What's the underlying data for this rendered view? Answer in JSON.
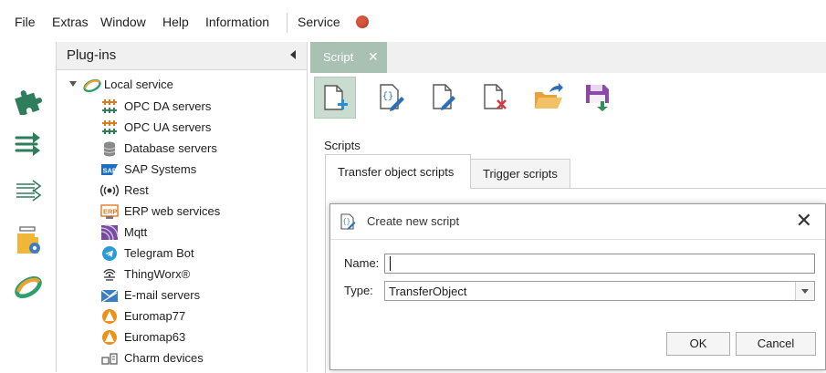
{
  "menu": {
    "items": [
      "File",
      "Extras",
      "Window",
      "Help",
      "Information"
    ],
    "service_label": "Service",
    "service_status_color": "#d9563e"
  },
  "side_strip": {
    "icons": [
      "puzzle-icon",
      "transfer-arrows-icon",
      "transfer-outline-arrows-icon",
      "server-settings-icon",
      "ring-logo-icon"
    ],
    "accent_color": "#2e7d5b"
  },
  "plugins_pane": {
    "title": "Plug-ins",
    "root": {
      "label": "Local service",
      "icon": "local-service-icon",
      "expanded": true
    },
    "items": [
      {
        "label": "OPC DA servers",
        "icon": "opc-da-icon"
      },
      {
        "label": "OPC UA servers",
        "icon": "opc-ua-icon"
      },
      {
        "label": "Database servers",
        "icon": "database-icon"
      },
      {
        "label": "SAP Systems",
        "icon": "sap-icon"
      },
      {
        "label": "Rest",
        "icon": "rest-icon"
      },
      {
        "label": "ERP web services",
        "icon": "erp-icon"
      },
      {
        "label": "Mqtt",
        "icon": "mqtt-icon"
      },
      {
        "label": "Telegram Bot",
        "icon": "telegram-icon"
      },
      {
        "label": "ThingWorx®",
        "icon": "thingworx-icon"
      },
      {
        "label": "E-mail servers",
        "icon": "email-icon"
      },
      {
        "label": "Euromap77",
        "icon": "euromap-icon"
      },
      {
        "label": "Euromap63",
        "icon": "euromap-icon"
      },
      {
        "label": "Charm devices",
        "icon": "charm-icon"
      }
    ]
  },
  "editor": {
    "doc_tab": {
      "label": "Script",
      "close": "✕"
    },
    "toolbar": [
      "new-script-icon",
      "edit-script-code-icon",
      "edit-script-icon",
      "delete-script-icon",
      "open-folder-icon",
      "save-download-icon"
    ],
    "scripts_label": "Scripts",
    "tabs": [
      {
        "label": "Transfer object scripts",
        "active": true
      },
      {
        "label": "Trigger scripts",
        "active": false
      }
    ]
  },
  "dialog": {
    "title": "Create new script",
    "close": "✕",
    "name_label": "Name:",
    "name_value": "",
    "type_label": "Type:",
    "type_value": "TransferObject",
    "ok_label": "OK",
    "cancel_label": "Cancel"
  }
}
